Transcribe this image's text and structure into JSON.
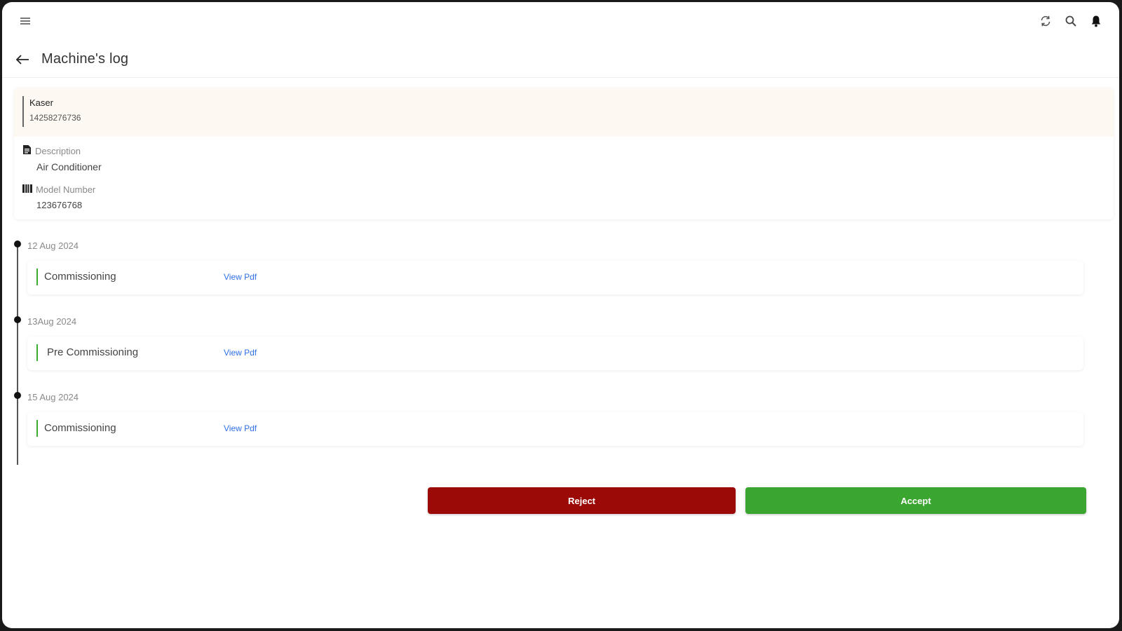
{
  "topbar": {
    "menu_icon": "menu-icon",
    "sync_icon": "sync-icon",
    "search_icon": "search-icon",
    "bell_icon": "bell-icon"
  },
  "header": {
    "back_icon": "arrow-left-icon",
    "title": "Machine's log"
  },
  "machine": {
    "name": "Kaser",
    "serial": "14258276736",
    "description_label": "Description",
    "description_icon": "document-icon",
    "description": "Air Conditioner",
    "model_label": "Model Number",
    "model_icon": "barcode-icon",
    "model_number": "123676768"
  },
  "timeline": [
    {
      "date": "12 Aug 2024",
      "type": "Commissioning",
      "link": "View Pdf"
    },
    {
      "date": "13Aug 2024",
      "type": "Pre Commissioning",
      "link": "View Pdf"
    },
    {
      "date": "15 Aug 2024",
      "type": "Commissioning",
      "link": "View Pdf"
    }
  ],
  "actions": {
    "reject_label": "Reject",
    "accept_label": "Accept"
  },
  "colors": {
    "reject": "#9b0a06",
    "accept": "#3aa52f",
    "link": "#2f6fe4",
    "highlight_bg": "#fdf8f1"
  }
}
